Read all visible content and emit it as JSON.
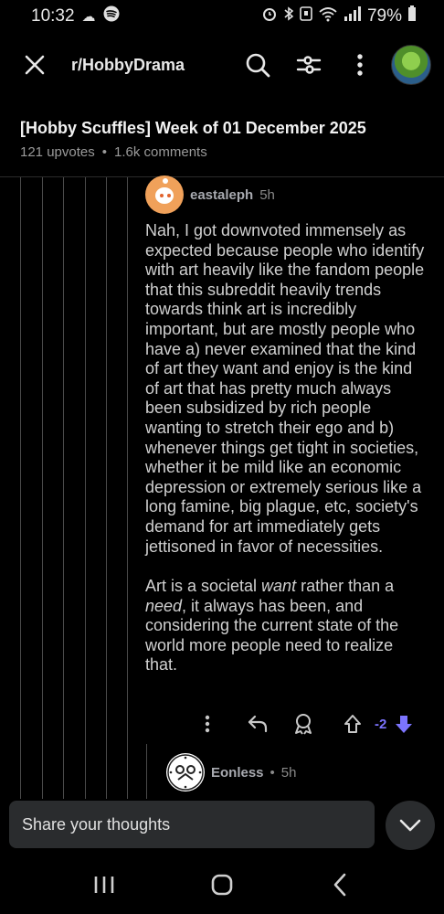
{
  "status_bar": {
    "time": "10:32",
    "battery": "79%"
  },
  "app_bar": {
    "subreddit": "r/HobbyDrama"
  },
  "post": {
    "title": "[Hobby Scuffles] Week of 01 December 2025",
    "upvotes": "121 upvotes",
    "separator": "•",
    "comments": "1.6k comments"
  },
  "comment": {
    "author": "eastaleph",
    "time": "5h",
    "paragraph1": "Nah, I got downvoted immensely as expected because people who identify with art heavily like the fandom people that this subreddit heavily trends towards think art is incredibly important, but are mostly people who have a) never examined that the kind of art they want and enjoy is the kind of art that has pretty much always been subsidized by rich people wanting to stretch their ego and b) whenever things get tight in societies, whether it be mild like an economic depression or extremely serious like a long famine, big plague, etc, society's demand for art immediately gets jettisoned in favor of necessities.",
    "p2_a": "Art is a societal ",
    "p2_want": "want",
    "p2_b": " rather than a ",
    "p2_need": "need",
    "p2_c": ", it always has been, and considering the current state of the world more people need to realize that.",
    "vote_count": "-2"
  },
  "reply": {
    "author": "Eonless",
    "time_prefix": "•",
    "time": "5h"
  },
  "composer": {
    "placeholder": "Share your thoughts"
  },
  "colors": {
    "background": "#000000",
    "downvote_accent": "#7c74ff",
    "author_avatar": "#f0a15a"
  }
}
